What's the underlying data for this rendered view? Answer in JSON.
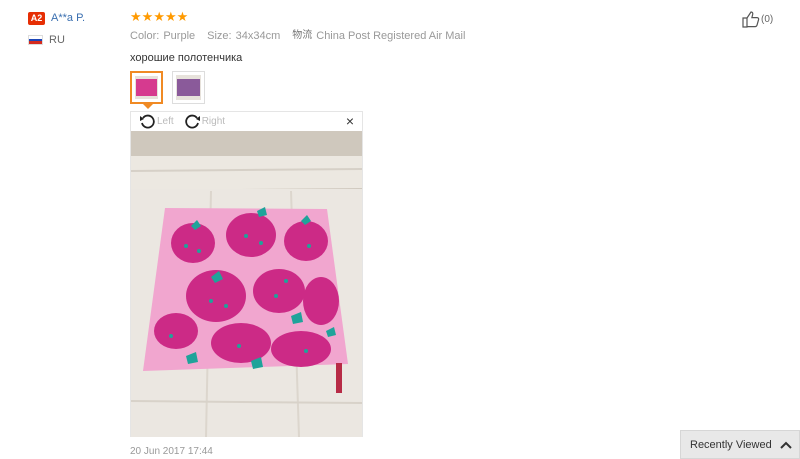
{
  "reviewer": {
    "level_badge": "A2",
    "name": "A**a P.",
    "country": "RU"
  },
  "review": {
    "rating": 5,
    "color_label": "Color:",
    "color_value": "Purple",
    "size_label": "Size:",
    "size_value": "34x34cm",
    "shipping_label": "物流",
    "shipping_value": "China Post Registered Air Mail",
    "text": "хорошие полотенчика",
    "date": "20 Jun 2017 17:44"
  },
  "viewer": {
    "rotate_left_label": "Left",
    "rotate_right_label": "Right",
    "close_label": "×"
  },
  "helpful": {
    "count": "(0)"
  },
  "recently_viewed": {
    "label": "Recently Viewed"
  },
  "colors": {
    "accent": "#f08a24",
    "star": "#ff9a00",
    "badge": "#e62e04",
    "link": "#3a6fb0"
  }
}
